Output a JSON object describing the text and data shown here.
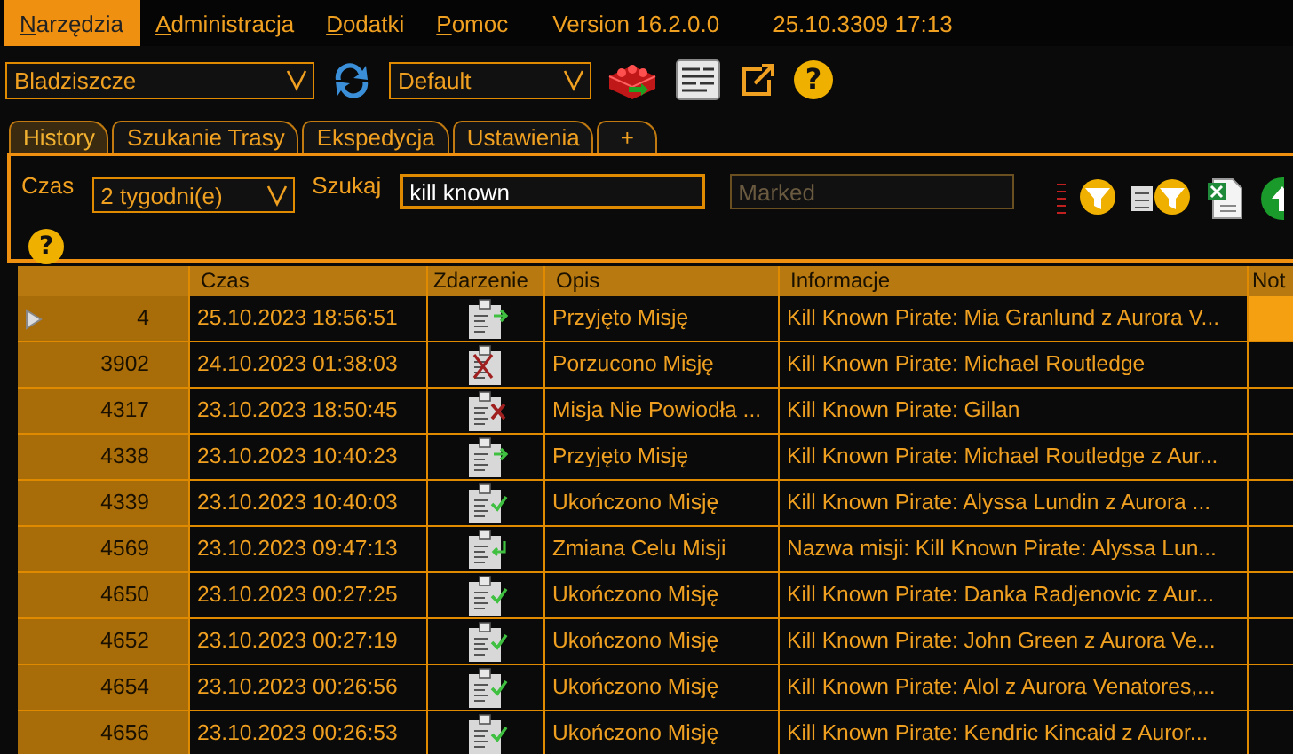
{
  "menu": [
    {
      "label": "Narzędzia",
      "selected": true
    },
    {
      "label": "Administracja",
      "selected": false
    },
    {
      "label": "Dodatki",
      "selected": false
    },
    {
      "label": "Pomoc",
      "selected": false
    }
  ],
  "version": "Version 16.2.0.0",
  "datetime": "25.10.3309 17:13",
  "toolbar": {
    "location": "Bladziszcze",
    "profile": "Default",
    "help": "?"
  },
  "tabs": [
    {
      "label": "History",
      "selected": true
    },
    {
      "label": "Szukanie Trasy",
      "selected": false
    },
    {
      "label": "Ekspedycja",
      "selected": false
    },
    {
      "label": "Ustawienia",
      "selected": false
    },
    {
      "label": "+",
      "selected": false
    }
  ],
  "filters": {
    "time_label": "Czas",
    "time_value": "2 tygodni(e)",
    "search_label": "Szukaj",
    "search_value": "kill known",
    "marked_placeholder": "Marked",
    "help": "?"
  },
  "table": {
    "columns": [
      "Czas",
      "Zdarzenie",
      "Opis",
      "Informacje",
      "Not"
    ],
    "rows": [
      {
        "selected": true,
        "id": "4",
        "time": "25.10.2023 18:56:51",
        "kind": "accepted",
        "description": "Przyjęto Misję",
        "info": "Kill Known Pirate: Mia Granlund z Aurora V..."
      },
      {
        "selected": false,
        "id": "3902",
        "time": "24.10.2023 01:38:03",
        "kind": "abandoned",
        "description": "Porzucono Misję",
        "info": "Kill Known Pirate: Michael Routledge"
      },
      {
        "selected": false,
        "id": "4317",
        "time": "23.10.2023 18:50:45",
        "kind": "failed",
        "description": "Misja Nie Powiodła ...",
        "info": "Kill Known Pirate: Gillan"
      },
      {
        "selected": false,
        "id": "4338",
        "time": "23.10.2023 10:40:23",
        "kind": "accepted",
        "description": "Przyjęto Misję",
        "info": "Kill Known Pirate: Michael Routledge z Aur..."
      },
      {
        "selected": false,
        "id": "4339",
        "time": "23.10.2023 10:40:03",
        "kind": "completed",
        "description": "Ukończono Misję",
        "info": "Kill Known Pirate: Alyssa Lundin z Aurora ..."
      },
      {
        "selected": false,
        "id": "4569",
        "time": "23.10.2023 09:47:13",
        "kind": "redirected",
        "description": "Zmiana Celu Misji",
        "info": "Nazwa misji: Kill Known Pirate: Alyssa Lun..."
      },
      {
        "selected": false,
        "id": "4650",
        "time": "23.10.2023 00:27:25",
        "kind": "completed",
        "description": "Ukończono Misję",
        "info": "Kill Known Pirate: Danka Radjenovic z Aur..."
      },
      {
        "selected": false,
        "id": "4652",
        "time": "23.10.2023 00:27:19",
        "kind": "completed",
        "description": "Ukończono Misję",
        "info": "Kill Known Pirate: John Green z Aurora Ve..."
      },
      {
        "selected": false,
        "id": "4654",
        "time": "23.10.2023 00:26:56",
        "kind": "completed",
        "description": "Ukończono Misję",
        "info": "Kill Known Pirate: Alol z Aurora Venatores,..."
      },
      {
        "selected": false,
        "id": "4656",
        "time": "23.10.2023 00:26:53",
        "kind": "completed",
        "description": "Ukończono Misję",
        "info": "Kill Known Pirate: Kendric Kincaid z Auror..."
      }
    ]
  }
}
